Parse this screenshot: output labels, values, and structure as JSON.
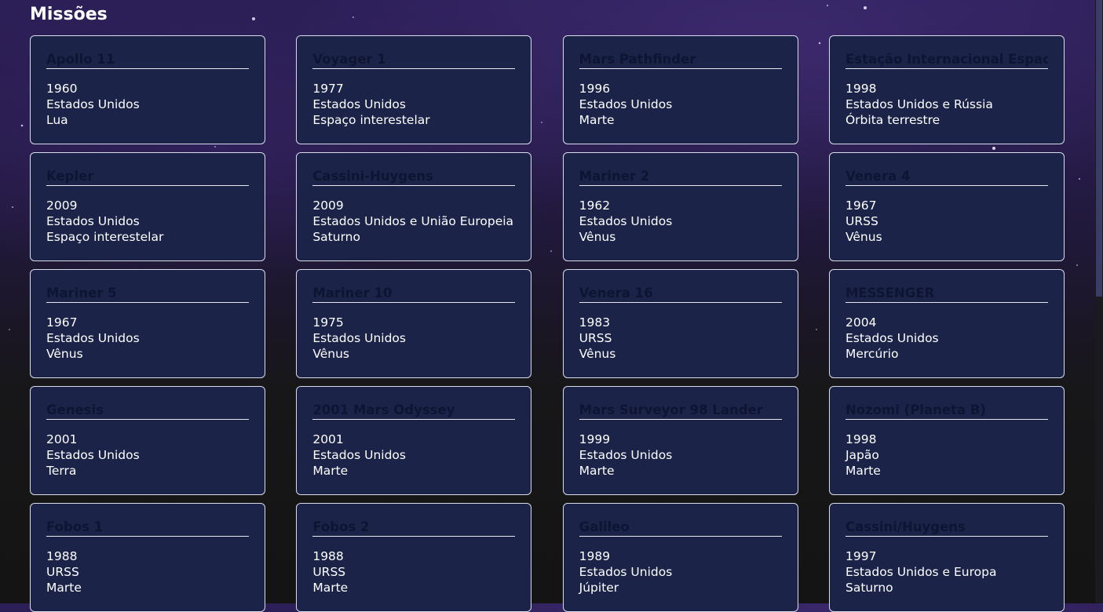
{
  "page": {
    "title": "Missões"
  },
  "missions": [
    {
      "name": "Apollo 11",
      "year": "1960",
      "country": "Estados Unidos",
      "destination": "Lua"
    },
    {
      "name": "Voyager 1",
      "year": "1977",
      "country": "Estados Unidos",
      "destination": "Espaço interestelar"
    },
    {
      "name": "Mars Pathfinder",
      "year": "1996",
      "country": "Estados Unidos",
      "destination": "Marte"
    },
    {
      "name": "Estação Internacional Espacial",
      "year": "1998",
      "country": "Estados Unidos e Rússia",
      "destination": "Órbita terrestre"
    },
    {
      "name": "Kepler",
      "year": "2009",
      "country": "Estados Unidos",
      "destination": "Espaço interestelar"
    },
    {
      "name": "Cassini-Huygens",
      "year": "2009",
      "country": "Estados Unidos e União Europeia",
      "destination": "Saturno"
    },
    {
      "name": "Mariner 2",
      "year": "1962",
      "country": "Estados Unidos",
      "destination": "Vênus"
    },
    {
      "name": "Venera 4",
      "year": "1967",
      "country": "URSS",
      "destination": "Vênus"
    },
    {
      "name": "Mariner 5",
      "year": "1967",
      "country": "Estados Unidos",
      "destination": "Vênus"
    },
    {
      "name": "Mariner 10",
      "year": "1975",
      "country": "Estados Unidos",
      "destination": "Vênus"
    },
    {
      "name": "Venera 16",
      "year": "1983",
      "country": "URSS",
      "destination": "Vênus"
    },
    {
      "name": "MESSENGER",
      "year": "2004",
      "country": "Estados Unidos",
      "destination": "Mercúrio"
    },
    {
      "name": "Genesis",
      "year": "2001",
      "country": "Estados Unidos",
      "destination": "Terra"
    },
    {
      "name": "2001 Mars Odyssey",
      "year": "2001",
      "country": "Estados Unidos",
      "destination": "Marte"
    },
    {
      "name": "Mars Surveyor 98 Lander",
      "year": "1999",
      "country": "Estados Unidos",
      "destination": "Marte"
    },
    {
      "name": "Nozomi (Planeta B)",
      "year": "1998",
      "country": "Japão",
      "destination": "Marte"
    },
    {
      "name": "Fobos 1",
      "year": "1988",
      "country": "URSS",
      "destination": "Marte"
    },
    {
      "name": "Fobos 2",
      "year": "1988",
      "country": "URSS",
      "destination": "Marte"
    },
    {
      "name": "Galileo",
      "year": "1989",
      "country": "Estados Unidos",
      "destination": "Júpiter"
    },
    {
      "name": "Cassini/Huygens",
      "year": "1997",
      "country": "Estados Unidos e Europa",
      "destination": "Saturno"
    }
  ],
  "colors": {
    "card_background": "#1b2448",
    "card_border": "#d9dceb",
    "card_title": "#0d1532",
    "text": "#ffffff"
  }
}
